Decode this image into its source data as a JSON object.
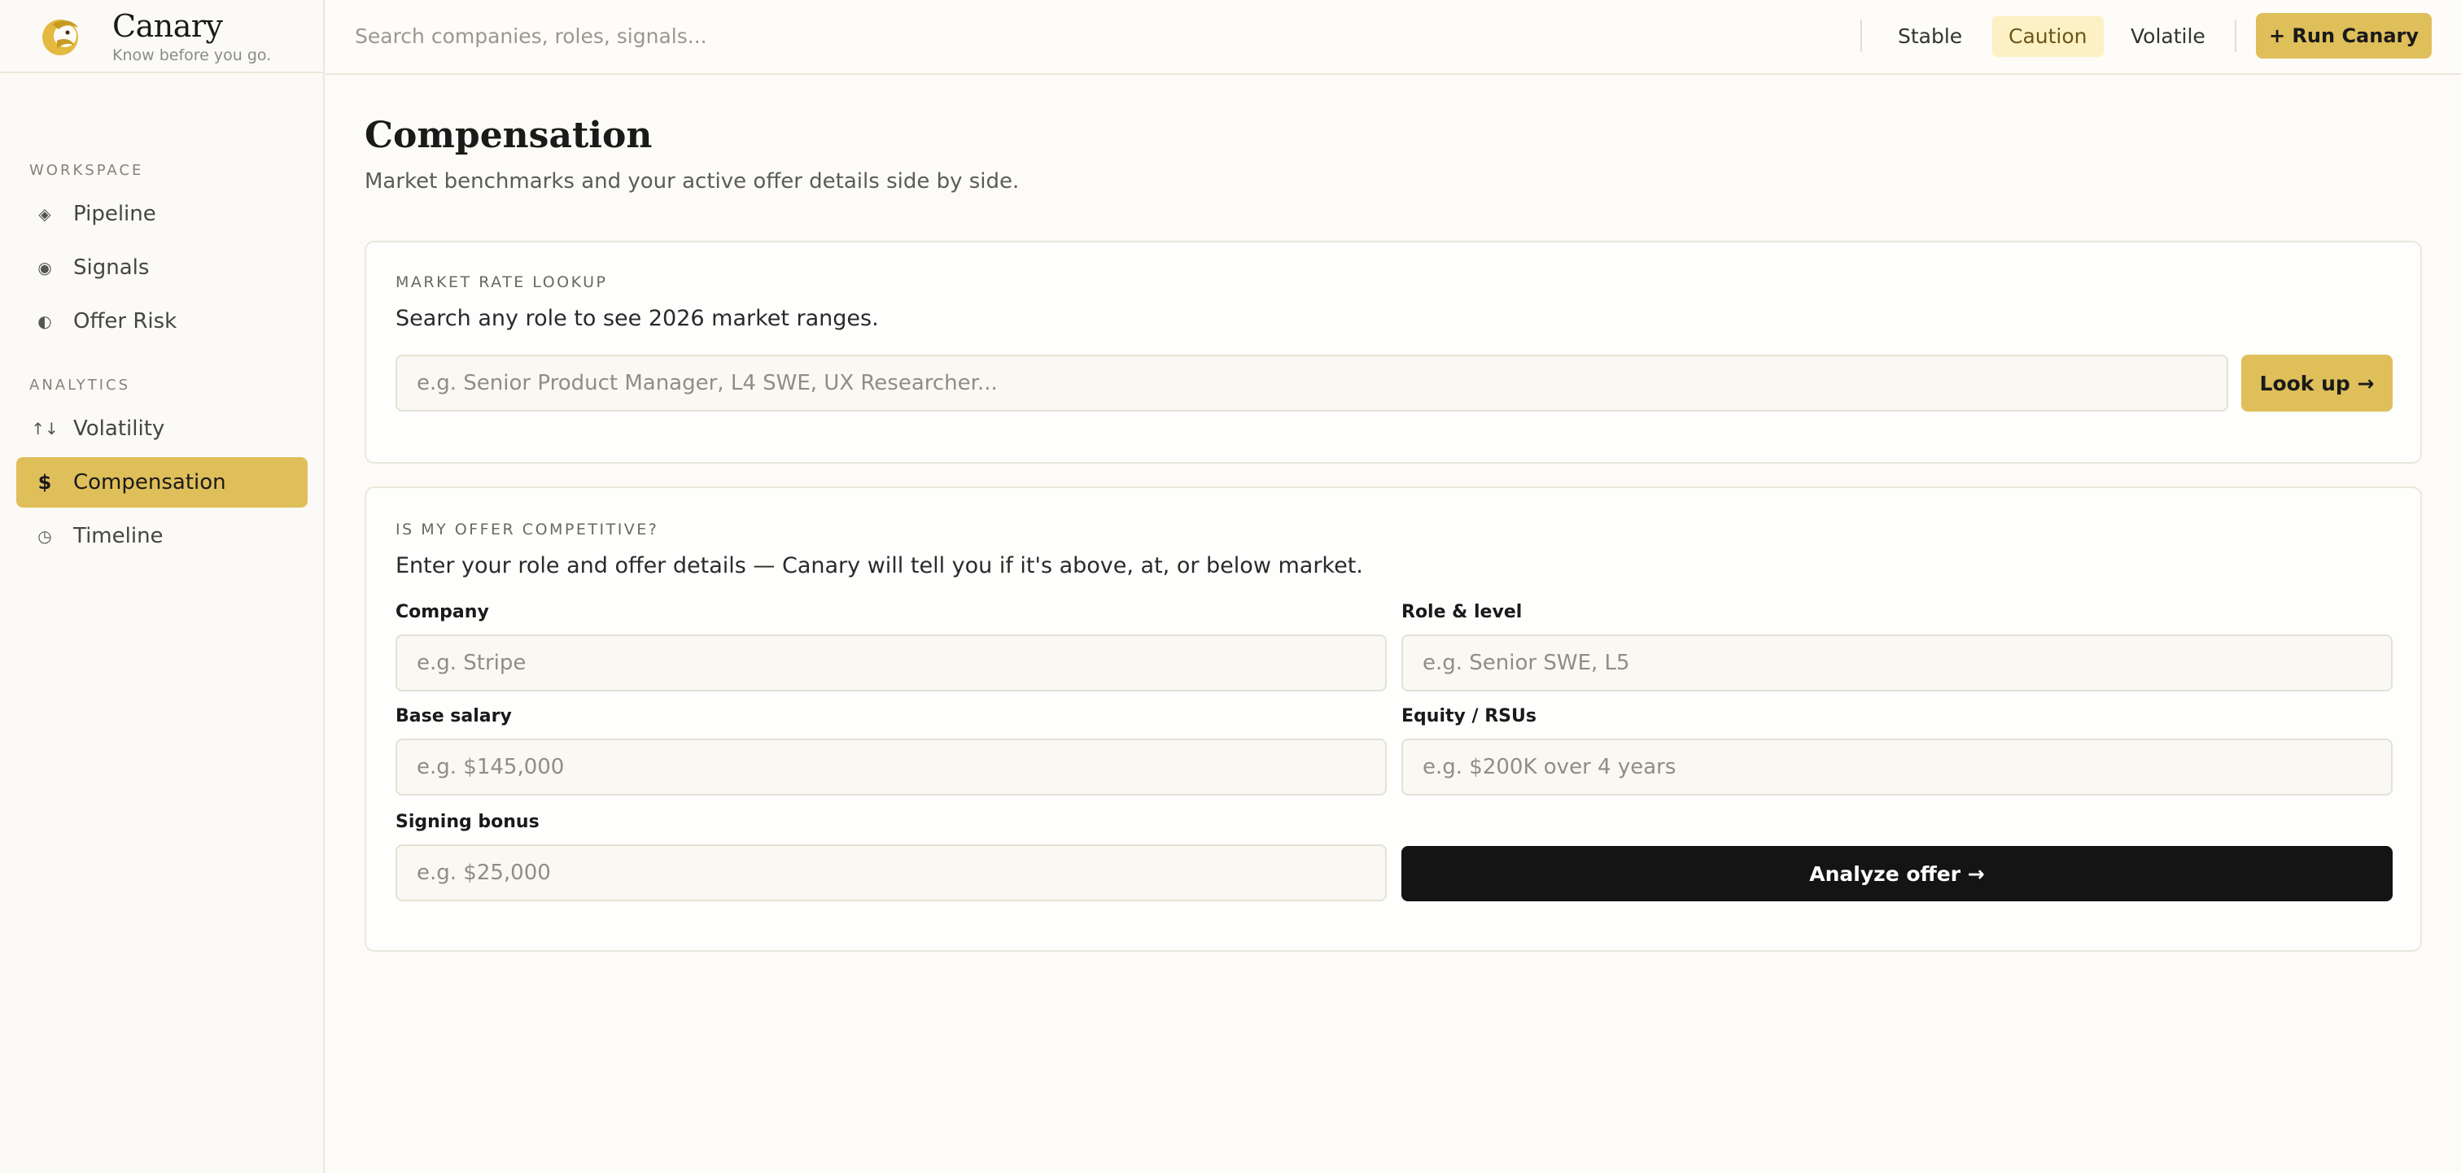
{
  "brand": {
    "name": "Canary",
    "tagline": "Know before you go."
  },
  "colors": {
    "accent": "#dfbf5a",
    "caution_bg": "#fbf1c4",
    "dark_button": "#141414"
  },
  "sidebar": {
    "workspace_label": "WORKSPACE",
    "analytics_label": "ANALYTICS",
    "workspace_items": [
      {
        "label": "Pipeline",
        "icon": "diamond-icon",
        "glyph": "◈"
      },
      {
        "label": "Signals",
        "icon": "target-icon",
        "glyph": "◉"
      },
      {
        "label": "Offer Risk",
        "icon": "half-circle-icon",
        "glyph": "◐"
      }
    ],
    "analytics_items": [
      {
        "label": "Volatility",
        "icon": "arrows-up-down-icon",
        "glyph": "↑↓"
      },
      {
        "label": "Compensation",
        "icon": "dollar-icon",
        "glyph": "$",
        "active": true
      },
      {
        "label": "Timeline",
        "icon": "clock-icon",
        "glyph": "◷"
      }
    ]
  },
  "topbar": {
    "search_placeholder": "Search companies, roles, signals...",
    "filters": [
      "Stable",
      "Caution",
      "Volatile"
    ],
    "run_label": "+ Run Canary"
  },
  "page": {
    "title": "Compensation",
    "subtitle": "Market benchmarks and your active offer details side by side."
  },
  "market_lookup": {
    "label": "MARKET RATE LOOKUP",
    "description": "Search any role to see 2026 market ranges.",
    "placeholder": "e.g. Senior Product Manager, L4 SWE, UX Researcher...",
    "button": "Look up →"
  },
  "offer_check": {
    "label": "IS MY OFFER COMPETITIVE?",
    "description": "Enter your role and offer details — Canary will tell you if it's above, at, or below market.",
    "fields": {
      "company": {
        "label": "Company",
        "placeholder": "e.g. Stripe"
      },
      "role": {
        "label": "Role & level",
        "placeholder": "e.g. Senior SWE, L5"
      },
      "base": {
        "label": "Base salary",
        "placeholder": "e.g. $145,000"
      },
      "equity": {
        "label": "Equity / RSUs",
        "placeholder": "e.g. $200K over 4 years"
      },
      "signing": {
        "label": "Signing bonus",
        "placeholder": "e.g. $25,000"
      }
    },
    "button": "Analyze offer →"
  }
}
